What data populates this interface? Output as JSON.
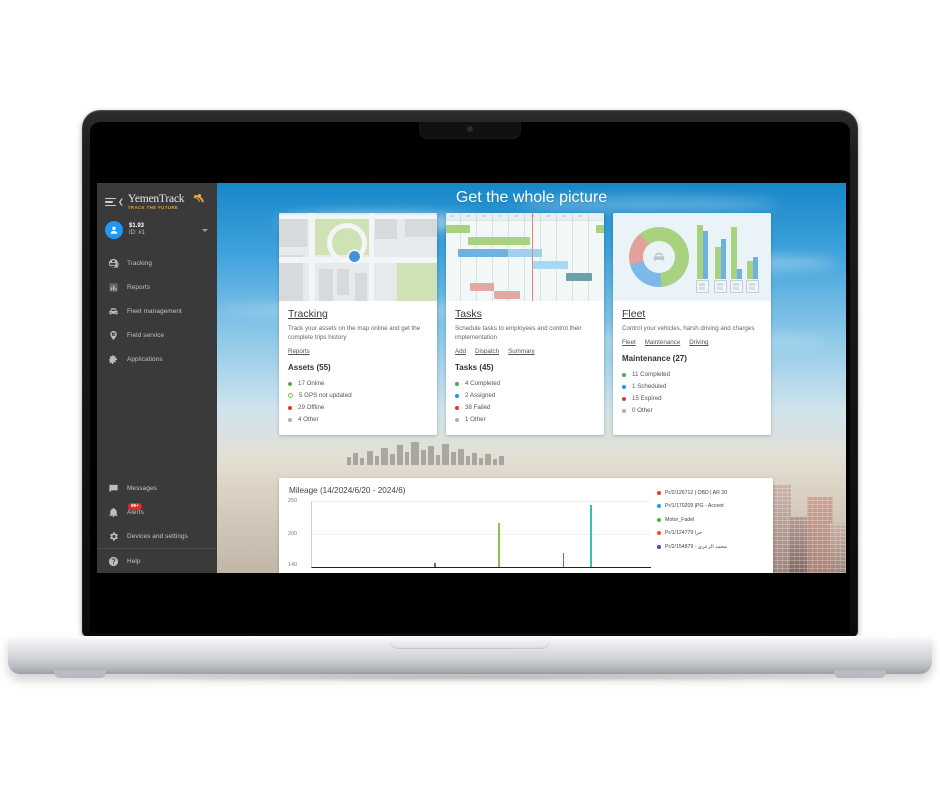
{
  "brand": {
    "name": "YemenTrack",
    "tagline": "Track The Future",
    "menu_icon": "hamburger-icon"
  },
  "user": {
    "balance": "$1.93",
    "id": "ID: #1"
  },
  "sidebar": {
    "items": [
      {
        "label": "Tracking",
        "icon": "globe-icon"
      },
      {
        "label": "Reports",
        "icon": "bar-chart-icon"
      },
      {
        "label": "Fleet management",
        "icon": "car-icon"
      },
      {
        "label": "Field service",
        "icon": "pin-clock-icon"
      },
      {
        "label": "Applications",
        "icon": "puzzle-icon"
      }
    ],
    "bottom_items": [
      {
        "label": "Messages",
        "icon": "chat-icon",
        "badge": ""
      },
      {
        "label": "Alerts",
        "icon": "bell-icon",
        "badge": "99+"
      },
      {
        "label": "Devices and settings",
        "icon": "gear-icon",
        "badge": ""
      },
      {
        "label": "Help",
        "icon": "question-circle-icon",
        "badge": ""
      }
    ]
  },
  "hero": {
    "title": "Get the whole picture"
  },
  "cards": [
    {
      "title": "Tracking",
      "description": "Track your assets on the map online and get the complete trips history",
      "links": [
        "Reports"
      ],
      "stat_title": "Assets (55)",
      "stats": [
        {
          "label": "17 Online",
          "color": "#4caf50",
          "style": "solid"
        },
        {
          "label": "5 GPS not updated",
          "color": "#7cc142",
          "style": "ring"
        },
        {
          "label": "29 Offline",
          "color": "#e53935",
          "style": "solid"
        },
        {
          "label": "4 Other",
          "color": "#b0b0b0",
          "style": "solid"
        }
      ]
    },
    {
      "title": "Tasks",
      "description": "Schedule tasks to employees and control their implementation",
      "links": [
        "Add",
        "Dispatch",
        "Summary"
      ],
      "stat_title": "Tasks (45)",
      "stats": [
        {
          "label": "4 Completed",
          "color": "#4caf50",
          "style": "solid"
        },
        {
          "label": "2 Assigned",
          "color": "#2196f3",
          "style": "solid"
        },
        {
          "label": "38 Failed",
          "color": "#e53935",
          "style": "solid"
        },
        {
          "label": "1 Other",
          "color": "#b0b0b0",
          "style": "solid"
        }
      ]
    },
    {
      "title": "Fleet",
      "description": "Control your vehicles, harsh driving and charges",
      "links": [
        "Fleet",
        "Maintenance",
        "Driving"
      ],
      "stat_title": "Maintenance (27)",
      "stats": [
        {
          "label": "11 Completed",
          "color": "#4caf50",
          "style": "solid"
        },
        {
          "label": "1 Scheduled",
          "color": "#2196f3",
          "style": "solid"
        },
        {
          "label": "15 Expired",
          "color": "#e53935",
          "style": "solid"
        },
        {
          "label": "0 Other",
          "color": "#b0b0b0",
          "style": "solid"
        }
      ]
    }
  ],
  "chart_data": {
    "type": "bar",
    "title": "Mileage (14/2024/6/20 - 2024/6)",
    "xlabel": "",
    "ylabel": "",
    "ylim": [
      140,
      250
    ],
    "yticks": [
      250,
      200,
      140
    ],
    "ytick_labels": [
      "250",
      "200",
      "140"
    ],
    "grid": true,
    "legend_position": "right",
    "series": [
      {
        "name": "Pr/2/126712 | OBD | AR 20",
        "color": "#e53935",
        "values": []
      },
      {
        "name": "Pr/1/170209 |PG - Accent",
        "color": "#2196f3",
        "values": []
      },
      {
        "name": "Motor_Fadel",
        "color": "#4caf50",
        "values": []
      },
      {
        "name": "Pr/1/124779 حرا",
        "color": "#f4511e",
        "values": []
      },
      {
        "name": "Pr/2/154879 - محمد الزعزي",
        "color": "#3f51b5",
        "values": []
      }
    ],
    "bars": [
      {
        "x_pct": 36,
        "value": 145,
        "color": "#7e57c2"
      },
      {
        "x_pct": 55,
        "value": 217,
        "color": "#8bc34a"
      },
      {
        "x_pct": 74,
        "value": 160,
        "color": "#9c4dcc"
      },
      {
        "x_pct": 82,
        "value": 245,
        "color": "#26c6c6"
      }
    ]
  }
}
